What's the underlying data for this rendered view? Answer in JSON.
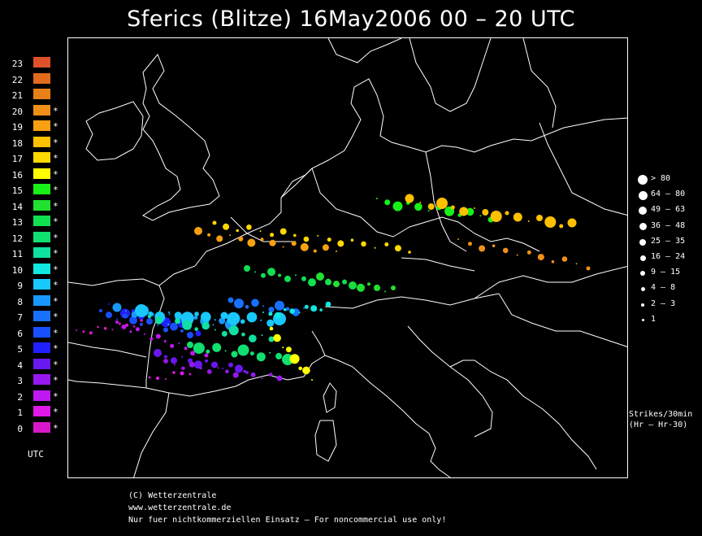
{
  "title": "Sferics (Blitze) 16May2006 00 – 20 UTC",
  "utc_legend": {
    "label": "UTC",
    "hours": [
      {
        "hour": "23",
        "color": "#e0502a",
        "active": false
      },
      {
        "hour": "22",
        "color": "#e46a1e",
        "active": false
      },
      {
        "hour": "21",
        "color": "#e8801a",
        "active": false
      },
      {
        "hour": "20",
        "color": "#f09018",
        "active": true
      },
      {
        "hour": "19",
        "color": "#f8a010",
        "active": true
      },
      {
        "hour": "18",
        "color": "#ffc000",
        "active": true
      },
      {
        "hour": "17",
        "color": "#ffd800",
        "active": true
      },
      {
        "hour": "16",
        "color": "#ffff00",
        "active": true
      },
      {
        "hour": "15",
        "color": "#18f018",
        "active": true
      },
      {
        "hour": "14",
        "color": "#20e030",
        "active": true
      },
      {
        "hour": "13",
        "color": "#10e050",
        "active": true
      },
      {
        "hour": "12",
        "color": "#10e070",
        "active": true
      },
      {
        "hour": "11",
        "color": "#10e0a0",
        "active": true
      },
      {
        "hour": "10",
        "color": "#10e8e0",
        "active": true
      },
      {
        "hour": "9",
        "color": "#18c8ff",
        "active": true
      },
      {
        "hour": "8",
        "color": "#1898ff",
        "active": true
      },
      {
        "hour": "7",
        "color": "#1870ff",
        "active": true
      },
      {
        "hour": "6",
        "color": "#1850ff",
        "active": true
      },
      {
        "hour": "5",
        "color": "#2020ff",
        "active": true
      },
      {
        "hour": "4",
        "color": "#6a18f0",
        "active": true
      },
      {
        "hour": "3",
        "color": "#9818f0",
        "active": true
      },
      {
        "hour": "2",
        "color": "#c018f0",
        "active": true
      },
      {
        "hour": "1",
        "color": "#e018e8",
        "active": true
      },
      {
        "hour": "0",
        "color": "#d818c8",
        "active": true
      }
    ],
    "star": "*"
  },
  "size_legend": [
    {
      "label": "> 80",
      "level": 10
    },
    {
      "label": "64 – 80",
      "level": 9
    },
    {
      "label": "49 – 63",
      "level": 8
    },
    {
      "label": "36 – 48",
      "level": 7
    },
    {
      "label": "25 – 35",
      "level": 6
    },
    {
      "label": "16 – 24",
      "level": 5
    },
    {
      "label": "9 – 15",
      "level": 4
    },
    {
      "label": "4 – 8",
      "level": 3
    },
    {
      "label": "2 – 3",
      "level": 2
    },
    {
      "label": "1",
      "level": 1
    }
  ],
  "strikes_caption": {
    "line1": "Strikes/30min",
    "line2": "(Hr – Hr-30)"
  },
  "footer": {
    "line1": "(C) Wetterzentrale",
    "line2": "www.wetterzentrale.de",
    "line3": "Nur fuer nichtkommerziellen Einsatz – For noncommercial use only!"
  }
}
